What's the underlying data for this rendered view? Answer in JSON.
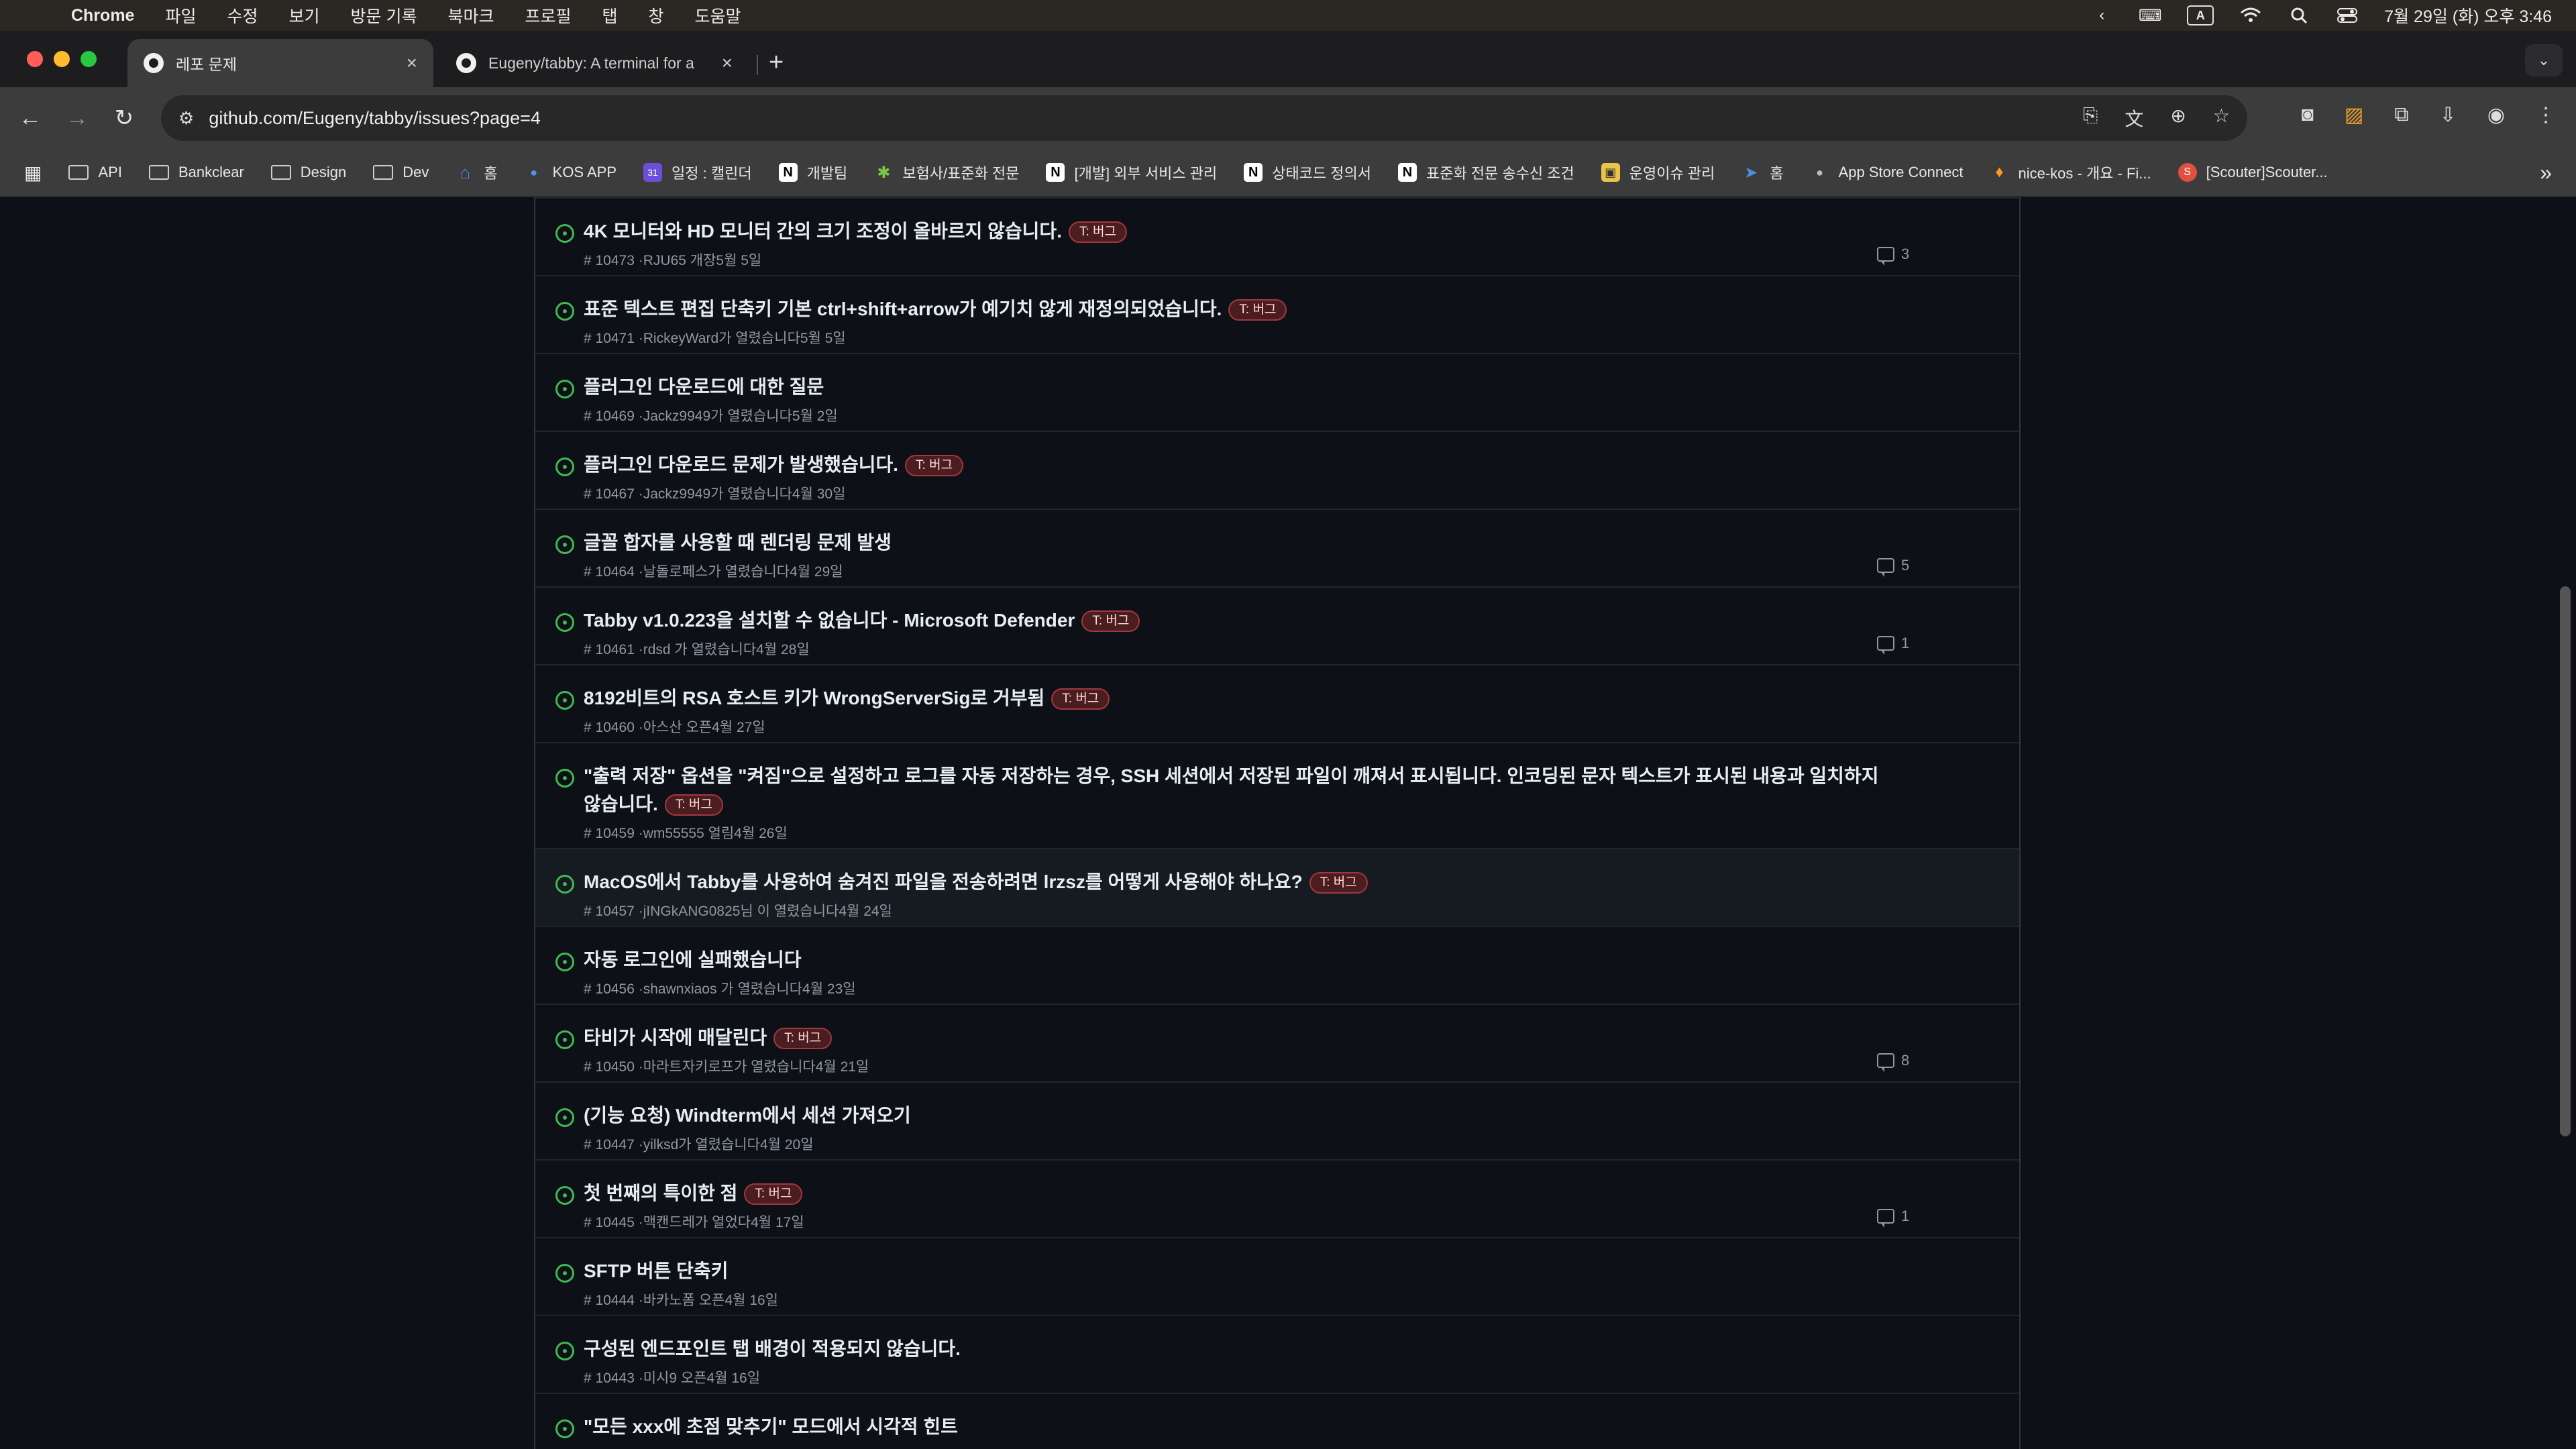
{
  "menubar": {
    "app": "Chrome",
    "items": [
      "파일",
      "수정",
      "보기",
      "방문 기록",
      "북마크",
      "프로필",
      "탭",
      "창",
      "도움말"
    ],
    "input_indicator": "A",
    "clock": "7월 29일 (화) 오후 3:46"
  },
  "tabs": [
    {
      "title": "레포 문제",
      "close": "×"
    },
    {
      "title": "Eugeny/tabby: A terminal for a",
      "close": "×"
    }
  ],
  "new_tab": "+",
  "tab_search": "⌄",
  "toolbar": {
    "url": "github.com/Eugeny/tabby/issues?page=4"
  },
  "bookmarks": {
    "items": [
      {
        "label": "API",
        "icon": "folder"
      },
      {
        "label": "Bankclear",
        "icon": "folder"
      },
      {
        "label": "Design",
        "icon": "folder"
      },
      {
        "label": "Dev",
        "icon": "folder"
      },
      {
        "label": "홈",
        "icon": "home"
      },
      {
        "label": "KOS APP",
        "icon": "app"
      },
      {
        "label": "일정 : 캘린더",
        "icon": "calendar"
      },
      {
        "label": "개발팀",
        "icon": "notion"
      },
      {
        "label": "보험사/표준화 전문",
        "icon": "puzzle"
      },
      {
        "label": "[개발] 외부 서비스 관리",
        "icon": "notion"
      },
      {
        "label": "상태코드 정의서",
        "icon": "notion"
      },
      {
        "label": "표준화 전문 송수신 조건",
        "icon": "notion"
      },
      {
        "label": "운영이슈 관리",
        "icon": "image"
      },
      {
        "label": "홈",
        "icon": "arrow"
      },
      {
        "label": "App Store Connect",
        "icon": "apple"
      },
      {
        "label": "nice-kos - 개요 - Fi...",
        "icon": "flame"
      },
      {
        "label": "[Scouter]Scouter...",
        "icon": "scouter"
      }
    ],
    "more": "»"
  },
  "issues": [
    {
      "title": "4K 모니터와 HD 모니터 간의 크기 조정이 올바르지 않습니다.",
      "label": "T: 버그",
      "meta": "# 10473 ·RJU65 개장5월 5일",
      "comments": "3"
    },
    {
      "title": "표준 텍스트 편집 단축키 기본 ctrl+shift+arrow가 예기치 않게 재정의되었습니다.",
      "label": "T: 버그",
      "meta": "# 10471 ·RickeyWard가 열렸습니다5월 5일",
      "comments": ""
    },
    {
      "title": "플러그인 다운로드에 대한 질문",
      "label": "",
      "meta": "# 10469 ·Jackz9949가 열렸습니다5월 2일",
      "comments": ""
    },
    {
      "title": "플러그인 다운로드 문제가 발생했습니다.",
      "label": "T: 버그",
      "meta": "# 10467 ·Jackz9949가 열렸습니다4월 30일",
      "comments": ""
    },
    {
      "title": "글꼴 합자를 사용할 때 렌더링 문제 발생",
      "label": "",
      "meta": "# 10464 ·날돌로페스가 열렸습니다4월 29일",
      "comments": "5"
    },
    {
      "title": "Tabby v1.0.223을 설치할 수 없습니다 - Microsoft Defender",
      "label": "T: 버그",
      "meta": "# 10461 ·rdsd 가 열렸습니다4월 28일",
      "comments": "1"
    },
    {
      "title": "8192비트의 RSA 호스트 키가 WrongServerSig로 거부됨",
      "label": "T: 버그",
      "meta": "# 10460 ·아스산 오픈4월 27일",
      "comments": ""
    },
    {
      "title": "\"출력 저장\" 옵션을 \"켜짐\"으로 설정하고 로그를 자동 저장하는 경우, SSH 세션에서 저장된 파일이 깨져서 표시됩니다. 인코딩된 문자 텍스트가 표시된 내용과 일치하지 않습니다.",
      "label": "T: 버그",
      "meta": "# 10459 ·wm55555 열림4월 26일",
      "comments": ""
    },
    {
      "title": "MacOS에서 Tabby를 사용하여 숨겨진 파일을 전송하려면 lrzsz를 어떻게 사용해야 하나요?",
      "label": "T: 버그",
      "meta": "# 10457 ·jINGkANG0825님 이 열렸습니다4월 24일",
      "comments": ""
    },
    {
      "title": "자동 로그인에 실패했습니다",
      "label": "",
      "meta": "# 10456 ·shawnxiaos 가 열렸습니다4월 23일",
      "comments": ""
    },
    {
      "title": "타비가 시작에 매달린다",
      "label": "T: 버그",
      "meta": "# 10450 ·마라트자키로프가 열렸습니다4월 21일",
      "comments": "8"
    },
    {
      "title": "(기능 요청) Windterm에서 세션 가져오기",
      "label": "",
      "meta": "# 10447 ·yilksd가 열렸습니다4월 20일",
      "comments": ""
    },
    {
      "title": "첫 번째의 특이한 점",
      "label": "T: 버그",
      "meta": "# 10445 ·맥캔드레가 열었다4월 17일",
      "comments": "1"
    },
    {
      "title": "SFTP 버튼 단축키",
      "label": "",
      "meta": "# 10444 ·바카노폼 오픈4월 16일",
      "comments": ""
    },
    {
      "title": "구성된 엔드포인트 탭 배경이 적용되지 않습니다.",
      "label": "",
      "meta": "# 10443 ·미시9 오픈4월 16일",
      "comments": ""
    },
    {
      "title": "\"모든 xxx에 초점 맞추기\" 모드에서 시각적 힌트",
      "label": "",
      "meta": "",
      "comments": ""
    }
  ]
}
